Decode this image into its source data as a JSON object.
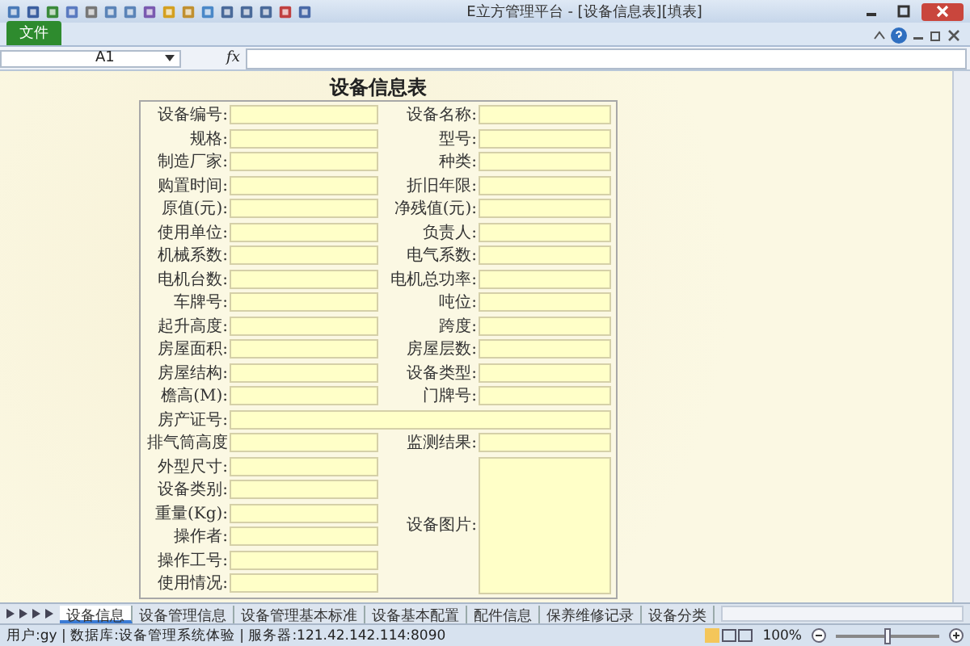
{
  "window": {
    "title": "E立方管理平台 - [设备信息表][填表]"
  },
  "ribbon": {
    "file_tab": "文件"
  },
  "formula_bar": {
    "name_box": "A1",
    "fx": "fx"
  },
  "form": {
    "title": "设备信息表",
    "rows": [
      {
        "kind": "pair",
        "left": "设备编号:",
        "right": "设备名称:"
      },
      {
        "kind": "pair",
        "left": "规格:",
        "right": "型号:"
      },
      {
        "kind": "pair",
        "left": "制造厂家:",
        "right": "种类:"
      },
      {
        "kind": "pair",
        "left": "购置时间:",
        "right": "折旧年限:"
      },
      {
        "kind": "pair",
        "left": "原值(元):",
        "right": "净残值(元):"
      },
      {
        "kind": "pair",
        "left": "使用单位:",
        "right": "负责人:"
      },
      {
        "kind": "pair",
        "left": "机械系数:",
        "right": "电气系数:"
      },
      {
        "kind": "pair",
        "left": "电机台数:",
        "right": "电机总功率:"
      },
      {
        "kind": "pair",
        "left": "车牌号:",
        "right": "吨位:"
      },
      {
        "kind": "pair",
        "left": "起升高度:",
        "right": "跨度:"
      },
      {
        "kind": "pair",
        "left": "房屋面积:",
        "right": "房屋层数:"
      },
      {
        "kind": "pair",
        "left": "房屋结构:",
        "right": "设备类型:"
      },
      {
        "kind": "pair",
        "left": "檐高(M):",
        "right": "门牌号:"
      },
      {
        "kind": "wide",
        "left": "房产证号:"
      },
      {
        "kind": "pair",
        "left": "排气筒高度",
        "right": "监测结果:"
      }
    ],
    "picture_section": {
      "picture_label": "设备图片:",
      "fields": [
        "外型尺寸:",
        "设备类别:",
        "重量(Kg):",
        "操作者:",
        "操作工号:",
        "使用情况:"
      ]
    }
  },
  "sheet_tabs": [
    {
      "label": "设备信息",
      "selected": true
    },
    {
      "label": "设备管理信息",
      "selected": false
    },
    {
      "label": "设备管理基本标准",
      "selected": false
    },
    {
      "label": "设备基本配置",
      "selected": false
    },
    {
      "label": "配件信息",
      "selected": false
    },
    {
      "label": "保养维修记录",
      "selected": false
    },
    {
      "label": "设备分类",
      "selected": false
    }
  ],
  "status_bar": {
    "text": "用户:gy | 数据库:设备管理系统体验 | 服务器:121.42.142.114:8090",
    "zoom": "100%",
    "zoom_slider": {
      "level": 0.5
    }
  }
}
